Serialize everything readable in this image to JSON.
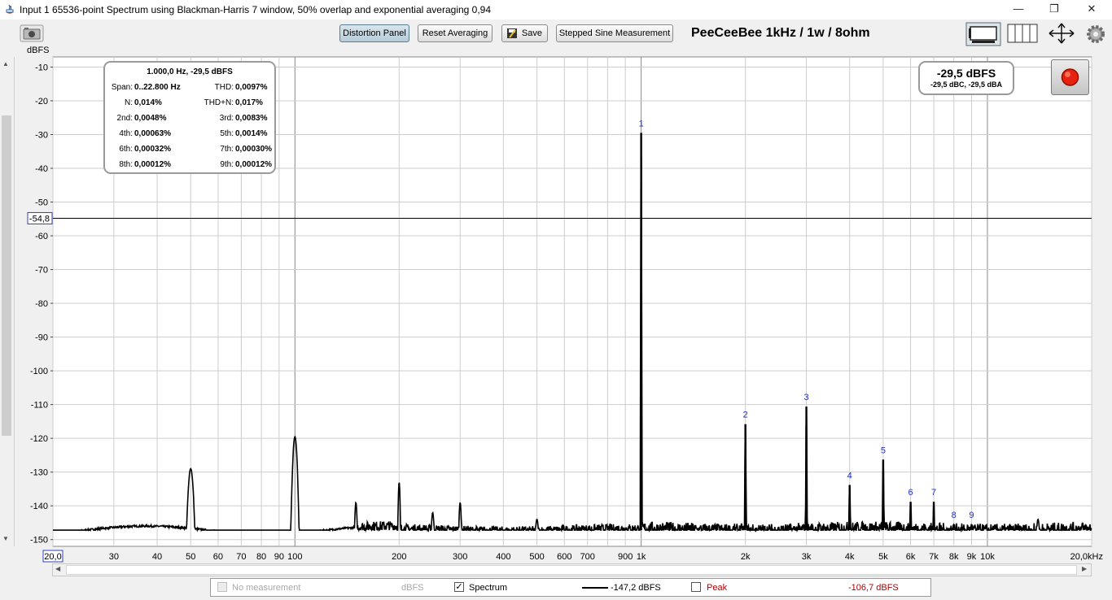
{
  "window": {
    "title": "Input 1 65536-point Spectrum using Blackman-Harris 7 window, 50% overlap and exponential averaging 0,94",
    "minimize_glyph": "—",
    "restore_glyph": "❐",
    "close_glyph": "✕"
  },
  "toolbar": {
    "distortion_panel_label": "Distortion Panel",
    "reset_averaging_label": "Reset Averaging",
    "save_label": "Save",
    "stepped_sine_label": "Stepped Sine Measurement",
    "graph_title": "PeeCeeBee 1kHz / 1w / 8ohm",
    "icons": [
      "camera-icon",
      "save-disk-icon",
      "graph-layout-icon",
      "grid-panel-icon",
      "expand-arrows-icon",
      "gear-icon"
    ]
  },
  "info_box": {
    "header": "1.000,0 Hz, -29,5 dBFS",
    "rows": [
      {
        "l_label": "Span:",
        "l_value": "0..22.800 Hz",
        "r_label": "THD:",
        "r_value": "0,0097%"
      },
      {
        "l_label": "N:",
        "l_value": "0,014%",
        "r_label": "THD+N:",
        "r_value": "0,017%"
      },
      {
        "l_label": "2nd:",
        "l_value": "0,0048%",
        "r_label": "3rd:",
        "r_value": "0,0083%"
      },
      {
        "l_label": "4th:",
        "l_value": "0,00063%",
        "r_label": "5th:",
        "r_value": "0,0014%"
      },
      {
        "l_label": "6th:",
        "l_value": "0,00032%",
        "r_label": "7th:",
        "r_value": "0,00030%"
      },
      {
        "l_label": "8th:",
        "l_value": "0,00012%",
        "r_label": "9th:",
        "r_value": "0,00012%"
      }
    ]
  },
  "level_box": {
    "main": "-29,5 dBFS",
    "sub": "-29,5 dBC, -29,5 dBA"
  },
  "legend": {
    "no_measurement": "No measurement",
    "no_measurement_unit": "dBFS",
    "spectrum_label": "Spectrum",
    "spectrum_value": "-147,2 dBFS",
    "spectrum_checked": true,
    "peak_label": "Peak",
    "peak_value": "-106,7 dBFS",
    "peak_checked": false,
    "peak_color": "#b00000"
  },
  "chart_data": {
    "type": "line",
    "xscale": "log",
    "xlim": [
      20,
      20000
    ],
    "ylim": [
      -152,
      -7
    ],
    "ylabel": "dBFS",
    "x_unit_label": "kHz",
    "x_start_label": "20,0",
    "x_end_label": "20,0kHz",
    "cursor_y_label": "-54,8",
    "cursor_y": -54.8,
    "grid": true,
    "y_ticks": [
      -10,
      -20,
      -30,
      -40,
      -50,
      -60,
      -70,
      -80,
      -90,
      -100,
      -110,
      -120,
      -130,
      -140,
      -150
    ],
    "x_tick_labels": [
      {
        "v": 30,
        "t": "30"
      },
      {
        "v": 40,
        "t": "40"
      },
      {
        "v": 50,
        "t": "50"
      },
      {
        "v": 60,
        "t": "60"
      },
      {
        "v": 70,
        "t": "70"
      },
      {
        "v": 80,
        "t": "80"
      },
      {
        "v": 90,
        "t": "90"
      },
      {
        "v": 100,
        "t": "100"
      },
      {
        "v": 200,
        "t": "200"
      },
      {
        "v": 300,
        "t": "300"
      },
      {
        "v": 400,
        "t": "400"
      },
      {
        "v": 500,
        "t": "500"
      },
      {
        "v": 600,
        "t": "600"
      },
      {
        "v": 700,
        "t": "700"
      },
      {
        "v": 900,
        "t": "900"
      },
      {
        "v": 1000,
        "t": "1k"
      },
      {
        "v": 2000,
        "t": "2k"
      },
      {
        "v": 3000,
        "t": "3k"
      },
      {
        "v": 4000,
        "t": "4k"
      },
      {
        "v": 5000,
        "t": "5k"
      },
      {
        "v": 6000,
        "t": "6k"
      },
      {
        "v": 7000,
        "t": "7k"
      },
      {
        "v": 8000,
        "t": "8k"
      },
      {
        "v": 9000,
        "t": "9k"
      },
      {
        "v": 10000,
        "t": "10k"
      }
    ],
    "harmonics": [
      {
        "n": "1",
        "freq": 1000,
        "level": -29.5
      },
      {
        "n": "2",
        "freq": 2000,
        "level": -115.8
      },
      {
        "n": "3",
        "freq": 3000,
        "level": -110.6
      },
      {
        "n": "4",
        "freq": 4000,
        "level": -133.8
      },
      {
        "n": "5",
        "freq": 5000,
        "level": -126.3
      },
      {
        "n": "6",
        "freq": 6000,
        "level": -138.8
      },
      {
        "n": "7",
        "freq": 7000,
        "level": -138.8
      },
      {
        "n": "8",
        "freq": 8000,
        "level": -145.5
      },
      {
        "n": "9",
        "freq": 9000,
        "level": -145.5
      }
    ],
    "spurs": [
      {
        "freq": 50,
        "level": -129
      },
      {
        "freq": 100,
        "level": -119.5
      },
      {
        "freq": 150,
        "level": -139
      },
      {
        "freq": 200,
        "level": -133
      },
      {
        "freq": 250,
        "level": -142
      },
      {
        "freq": 300,
        "level": -139
      },
      {
        "freq": 500,
        "level": -144
      },
      {
        "freq": 14000,
        "level": -144
      }
    ],
    "noise_floor": -147.2
  }
}
